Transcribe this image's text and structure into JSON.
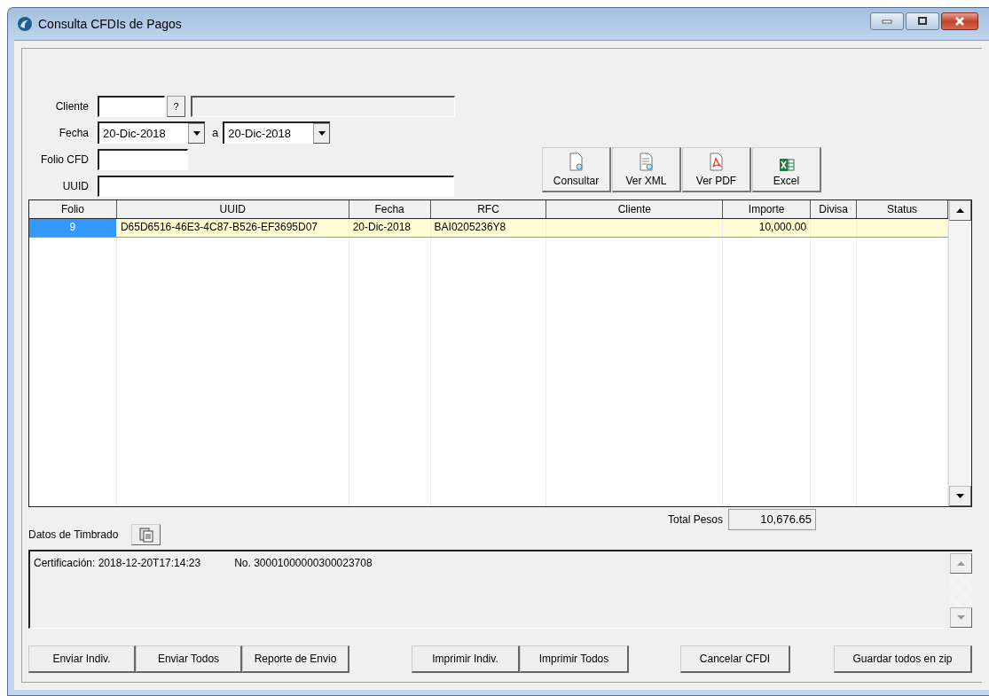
{
  "window": {
    "title": "Consulta CFDIs de Pagos"
  },
  "filters": {
    "cliente": {
      "label": "Cliente",
      "help": "?"
    },
    "fecha": {
      "label": "Fecha",
      "from": "20-Dic-2018",
      "sep": "a",
      "to": "20-Dic-2018"
    },
    "folio": {
      "label": "Folio CFD"
    },
    "uuid": {
      "label": "UUID"
    }
  },
  "toolbar": [
    {
      "label": "Consultar",
      "kind": "search"
    },
    {
      "label": "Ver XML",
      "kind": "xml"
    },
    {
      "label": "Ver PDF",
      "kind": "pdf"
    },
    {
      "label": "Excel",
      "kind": "excel"
    }
  ],
  "table": {
    "columns": [
      "Folio",
      "UUID",
      "Fecha",
      "RFC",
      "Cliente",
      "Importe",
      "Divisa",
      "Status"
    ],
    "rows": [
      {
        "selected": true,
        "cells": [
          "9",
          "D65D6516-46E3-4C87-B526-EF3695D07",
          "20-Dic-2018",
          "BAI0205236Y8",
          "",
          "10,000.00",
          "",
          ""
        ]
      }
    ]
  },
  "total": {
    "label": "Total Pesos",
    "value": "10,676.65"
  },
  "timbrado": {
    "label": "Datos de Timbrado",
    "certificacion": "Certificación: 2018-12-20T17:14:23",
    "numero": "No. 30001000000300023708"
  },
  "button_groups": [
    [
      "Enviar Indiv.",
      "Enviar Todos",
      "Reporte de Envio"
    ],
    [
      "Imprimir Indiv.",
      "Imprimir Todos"
    ],
    [
      "Cancelar CFDI"
    ],
    [
      "Guardar todos en zip"
    ]
  ]
}
